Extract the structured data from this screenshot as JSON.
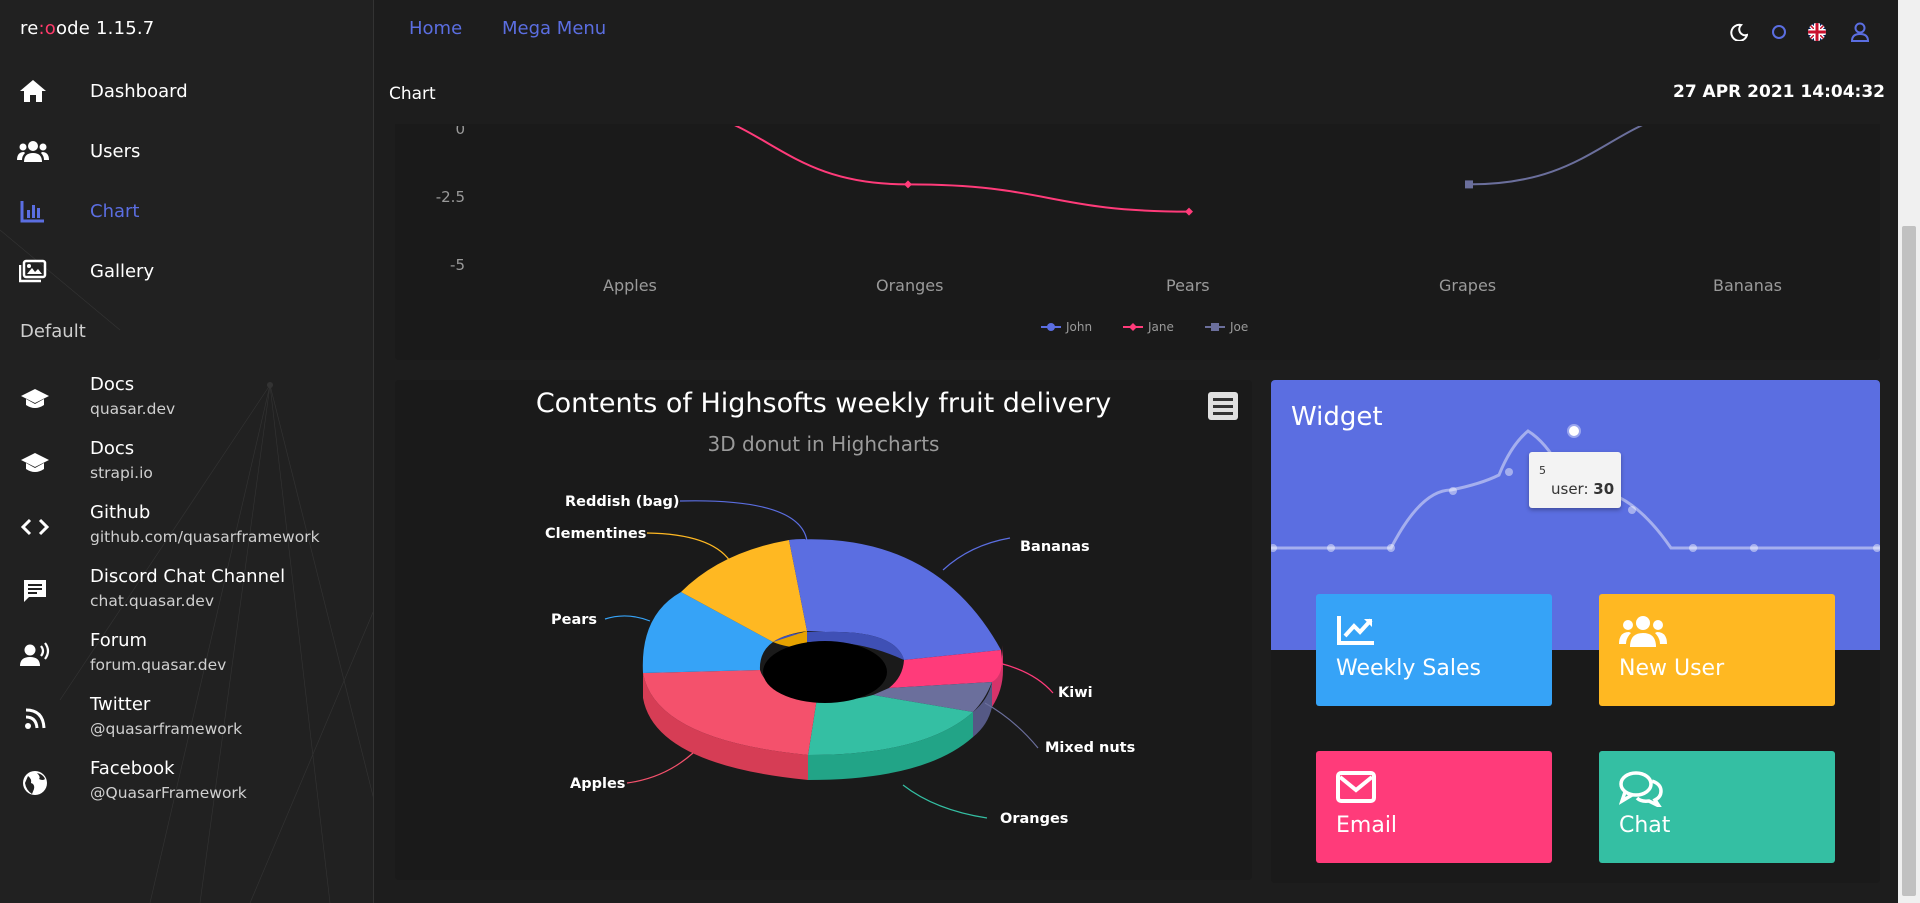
{
  "brand": {
    "prefix": "re",
    "accent": ":o",
    "suffix": "ode 1.15.7"
  },
  "sidebar": {
    "items": [
      {
        "label": "Dashboard",
        "icon": "home-icon"
      },
      {
        "label": "Users",
        "icon": "users-icon"
      },
      {
        "label": "Chart",
        "icon": "chart-icon",
        "active": true
      },
      {
        "label": "Gallery",
        "icon": "gallery-icon"
      }
    ],
    "section": "Default",
    "links": [
      {
        "title": "Docs",
        "sub": "quasar.dev",
        "icon": "school-icon"
      },
      {
        "title": "Docs",
        "sub": "strapi.io",
        "icon": "school-icon"
      },
      {
        "title": "Github",
        "sub": "github.com/quasarframework",
        "icon": "code-icon"
      },
      {
        "title": "Discord Chat Channel",
        "sub": "chat.quasar.dev",
        "icon": "chat-icon"
      },
      {
        "title": "Forum",
        "sub": "forum.quasar.dev",
        "icon": "record-voice-icon"
      },
      {
        "title": "Twitter",
        "sub": "@quasarframework",
        "icon": "rss-icon"
      },
      {
        "title": "Facebook",
        "sub": "@QuasarFramework",
        "icon": "public-icon"
      }
    ]
  },
  "header": {
    "links": [
      "Home",
      "Mega Menu"
    ],
    "icons": [
      "dark-mode-icon",
      "circle-icon",
      "uk-flag-icon",
      "user-icon"
    ],
    "page_title": "Chart",
    "datetime": "27 APR 2021 14:04:32"
  },
  "colors": {
    "accent": "#5b6ee1",
    "pink": "#ff3b7a",
    "orange": "#ffb822",
    "blue": "#36a3f7",
    "teal": "#34bfa3"
  },
  "chart_data": [
    {
      "type": "line",
      "categories": [
        "Apples",
        "Oranges",
        "Pears",
        "Grapes",
        "Bananas"
      ],
      "y_ticks": [
        "0",
        "-2.5",
        "-5"
      ],
      "ylim": [
        -5,
        0
      ],
      "series": [
        {
          "name": "John",
          "color": "#5b6ee1",
          "values": [
            null,
            null,
            null,
            null,
            null
          ]
        },
        {
          "name": "Jane",
          "color": "#ff3b7a",
          "values": [
            1,
            -2,
            -3,
            null,
            null
          ]
        },
        {
          "name": "Joe",
          "color": "#6b6f9c",
          "values": [
            null,
            null,
            null,
            -2,
            1
          ]
        }
      ],
      "legend": "bottom"
    },
    {
      "type": "pie",
      "title": "Contents of Highsofts weekly fruit delivery",
      "subtitle": "3D donut in Highcharts",
      "slices": [
        {
          "name": "Bananas",
          "color": "#5b6ee1"
        },
        {
          "name": "Kiwi",
          "color": "#ff3b7a"
        },
        {
          "name": "Mixed nuts",
          "color": "#6b6f9c"
        },
        {
          "name": "Oranges",
          "color": "#34bfa3"
        },
        {
          "name": "Apples",
          "color": "#f4516c"
        },
        {
          "name": "Pears",
          "color": "#36a3f7"
        },
        {
          "name": "Clementines",
          "color": "#ffb822"
        },
        {
          "name": "Reddish (bag)",
          "color": "#5b6ee1"
        }
      ]
    },
    {
      "type": "area",
      "title": "Widget",
      "tooltip": {
        "x": "5",
        "series": "user",
        "value": "30"
      }
    }
  ],
  "widget": {
    "tiles": [
      {
        "label": "Weekly Sales",
        "icon": "trending-up-icon"
      },
      {
        "label": "New User",
        "icon": "users-icon"
      },
      {
        "label": "Email",
        "icon": "envelope-icon"
      },
      {
        "label": "Chat",
        "icon": "comments-icon"
      }
    ]
  }
}
